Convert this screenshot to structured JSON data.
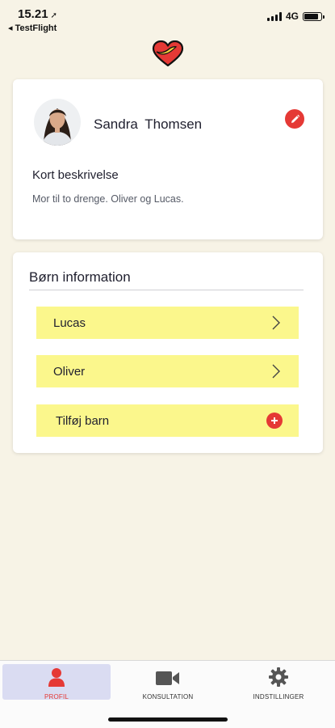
{
  "status_bar": {
    "time": "15.21",
    "back_app": "◂ TestFlight",
    "network": "4G"
  },
  "profile": {
    "name": "Sandra  Thomsen",
    "description_title": "Kort beskrivelse",
    "description_text": "Mor til to drenge. Oliver og Lucas."
  },
  "children": {
    "title": "Børn information",
    "items": [
      {
        "label": "Lucas"
      },
      {
        "label": "Oliver"
      }
    ],
    "add_label": "Tilføj barn"
  },
  "nav": {
    "items": [
      {
        "label": "PROFIL",
        "active": true
      },
      {
        "label": "KONSULTATION"
      },
      {
        "label": "INDSTILLINGER"
      }
    ]
  },
  "colors": {
    "background": "#f7f3e6",
    "accent_red": "#e53935",
    "row_yellow": "#fbf78c",
    "active_tab": "#dadcf2"
  },
  "icons": [
    "heart-logo-icon",
    "edit-pencil-icon",
    "chevron-right-icon",
    "add-plus-icon",
    "person-icon",
    "video-camera-icon",
    "gear-icon"
  ]
}
